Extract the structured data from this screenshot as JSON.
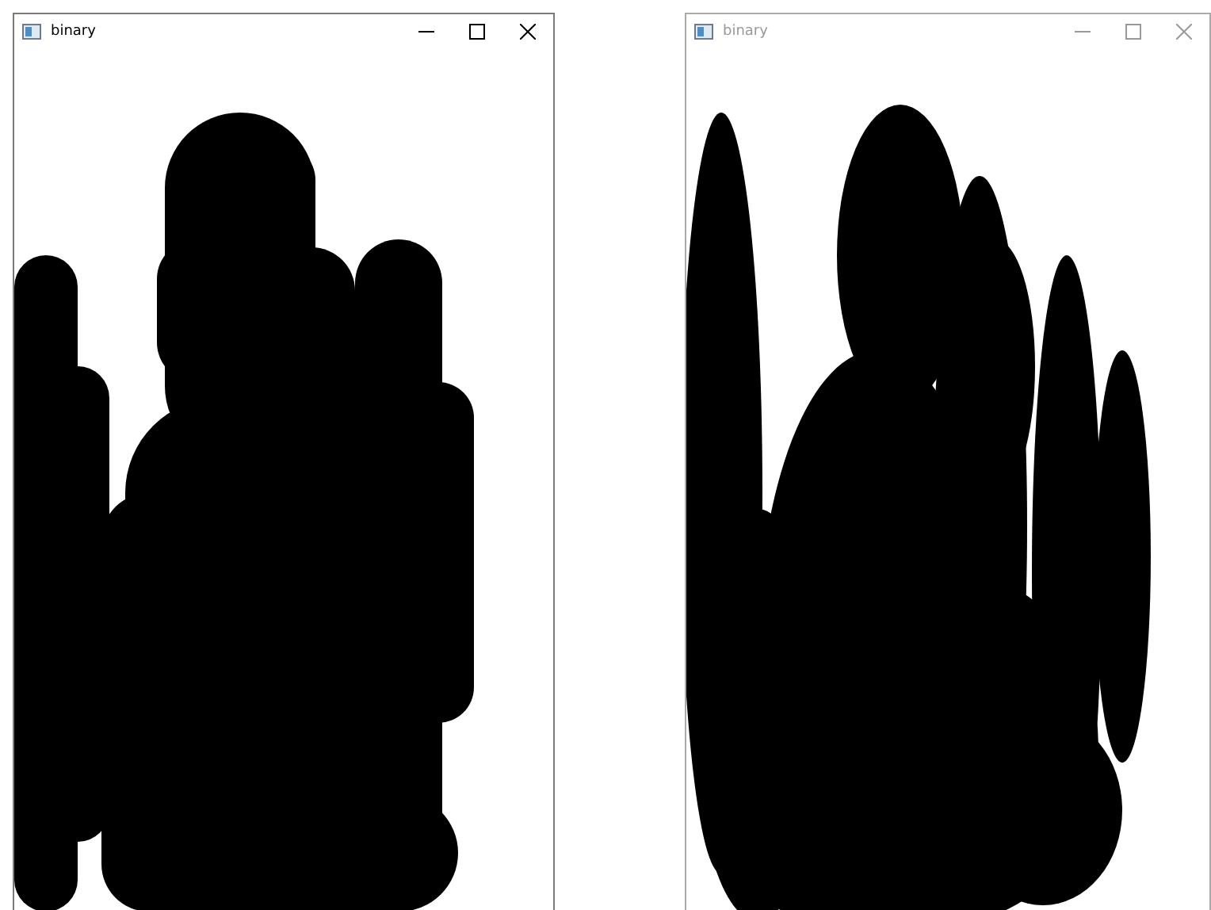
{
  "windows": [
    {
      "title": "binary",
      "active": true
    },
    {
      "title": "binary",
      "active": false
    }
  ]
}
